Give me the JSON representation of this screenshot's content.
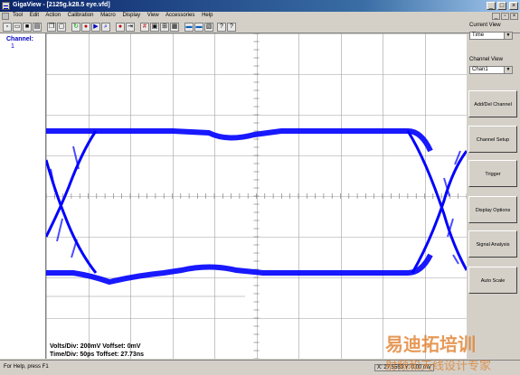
{
  "window": {
    "title": "GigaView - [2125g.k28.5 eye.vfd]"
  },
  "menu": [
    "Tool",
    "Edit",
    "Action",
    "Calibration",
    "Macro",
    "Display",
    "View",
    "Accessories",
    "Help"
  ],
  "toolbar_icons": [
    "new-icon",
    "open-icon",
    "save-icon",
    "print-icon",
    "copy-icon",
    "paste-icon",
    "refresh-icon",
    "record-icon",
    "run-icon",
    "zoom-icon",
    "arrow-icon",
    "stop-icon",
    "step-icon",
    "grid-icon",
    "scope-icon",
    "marker-icon",
    "window-icon",
    "chart-icon",
    "export-icon",
    "help-icon",
    "context-help-icon"
  ],
  "left_strip": {
    "label": "Channel:",
    "channel": "1"
  },
  "right_panel": {
    "current_view_label": "Current View",
    "current_view_value": "Time",
    "channel_view_label": "Channel View",
    "channel_view_value": "Chan1",
    "buttons": [
      "Add/Del Channel",
      "Channel Setup",
      "Trigger",
      "Display Options",
      "Signal Analysis",
      "Auto Scale"
    ]
  },
  "readout": {
    "volts": "Volts/Div: 200mV Voffset: 0mV",
    "time": "Time/Div: 50ps Toffset: 27.73ns"
  },
  "statusbar": {
    "help": "For Help, press F1",
    "coords": "X: 27.5563 Y: 0.00 mV"
  },
  "watermark": {
    "line1": "易迪拓培训",
    "line2": "射频和天线设计专家"
  },
  "colors": {
    "trace": "#0000ff",
    "grid": "#a0a0a0",
    "titlebar": "#0a246a"
  }
}
